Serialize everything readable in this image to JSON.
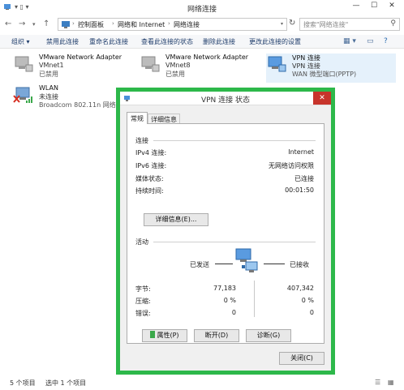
{
  "window": {
    "title": "网络连接",
    "min": "—",
    "max": "☐",
    "close": "✕"
  },
  "address": {
    "crumbs": [
      "控制面板",
      "网络和 Internet",
      "网络连接"
    ],
    "search_placeholder": "搜索\"网络连接\""
  },
  "toolbar": {
    "organize": "组织 ▾",
    "items": [
      "禁用此连接",
      "重命名此连接",
      "查看此连接的状态",
      "删除此连接",
      "更改此连接的设置"
    ]
  },
  "adapters": [
    {
      "name": "VMware Network Adapter",
      "line2": "VMnet1",
      "line3": "已禁用"
    },
    {
      "name": "VMware Network Adapter",
      "line2": "VMnet8",
      "line3": "已禁用"
    },
    {
      "name": "VPN 连接",
      "line2": "VPN 连接",
      "line3": "WAN 微型端口(PPTP)"
    },
    {
      "name": "WLAN",
      "line2": "未连接",
      "line3": "Broadcom 802.11n 网络适配"
    }
  ],
  "statusbar": {
    "count": "5 个项目",
    "selected": "选中 1 个项目"
  },
  "dialog": {
    "title": "VPN 连接 状态",
    "close": "✕",
    "tabs": [
      "常规",
      "详细信息"
    ],
    "connection_group": "连接",
    "rows": [
      {
        "key": "IPv4 连接:",
        "value": "Internet"
      },
      {
        "key": "IPv6 连接:",
        "value": "无网络访问权限"
      },
      {
        "key": "媒体状态:",
        "value": "已连接"
      },
      {
        "key": "持续时间:",
        "value": "00:01:50"
      }
    ],
    "details_button": "详细信息(E)...",
    "activity_group": "活动",
    "sent_label": "已发送",
    "recv_label": "已接收",
    "stats": [
      {
        "key": "字节:",
        "sent": "77,183",
        "recv": "407,342"
      },
      {
        "key": "压缩:",
        "sent": "0 %",
        "recv": "0 %"
      },
      {
        "key": "错误:",
        "sent": "0",
        "recv": "0"
      }
    ],
    "properties_button": "属性(P)",
    "disconnect_button": "断开(D)",
    "diagnose_button": "诊断(G)",
    "close_button": "关闭(C)"
  }
}
